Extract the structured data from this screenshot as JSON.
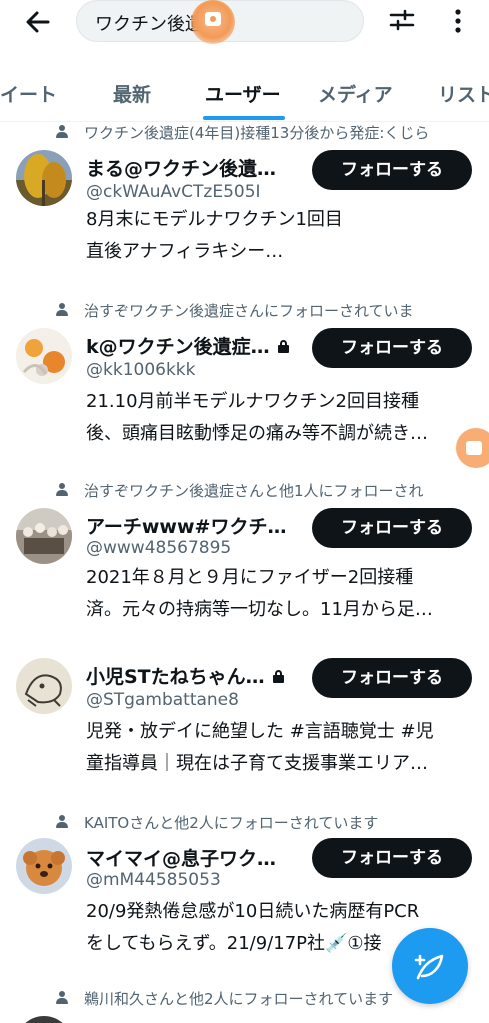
{
  "search": {
    "query": "ワクチン後遺症"
  },
  "tabs": [
    {
      "label": "イート",
      "active": false
    },
    {
      "label": "最新",
      "active": false
    },
    {
      "label": "ユーザー",
      "active": true
    },
    {
      "label": "メディア",
      "active": false
    },
    {
      "label": "リスト",
      "active": false
    }
  ],
  "users": [
    {
      "context": "ワクチン後遺症(4年目)接種13分後から発症:くじら",
      "name": "まる@ワクチン後遺…",
      "handle": "@ckWAuAvCTzE505I",
      "bio": [
        "8月末にモデルナワクチン1回目",
        "直後アナフィラキシー…"
      ],
      "follow_label": "フォローする",
      "locked": false
    },
    {
      "context": "治すぞワクチン後遺症さんにフォローされていま",
      "name": "k@ワクチン後遺症…",
      "handle": "@kk1006kkk",
      "bio": [
        "21.10月前半モデルナワクチン2回目接種",
        "後、頭痛目眩動悸足の痛み等不調が続き…"
      ],
      "follow_label": "フォローする",
      "locked": true
    },
    {
      "context": "治すぞワクチン後遺症さんと他1人にフォローされ",
      "name": "アーチwww#ワクチ…",
      "handle": "@www48567895",
      "bio": [
        "2021年８月と９月にファイザー2回接種",
        "済。元々の持病等一切なし。11月から足…"
      ],
      "follow_label": "フォローする",
      "locked": false
    },
    {
      "context": "",
      "name": "小児STたねちゃん…",
      "handle": "@STgambattane8",
      "bio": [
        "児発・放デイに絶望した #言語聴覚士 #児",
        "童指導員｜現在は子育て支援事業エリア…"
      ],
      "follow_label": "フォローする",
      "locked": true
    },
    {
      "context": "KAITOさんと他2人にフォローされています",
      "name": "マイマイ@息子ワク…",
      "handle": "@mM44585053",
      "bio": [
        "20/9発熱倦怠感が10日続いた病歴有PCR",
        "をしてもらえず。21/9/17P社💉①接"
      ],
      "follow_label": "フォローする",
      "locked": false
    },
    {
      "context": "鵜川和久さんと他2人にフォローされています",
      "name": "",
      "handle": "",
      "bio": [],
      "follow_label": "",
      "locked": false
    }
  ],
  "colors": {
    "accent": "#1d9bf0",
    "text": "#0f1419",
    "secondary": "#536471",
    "button": "#0f1419"
  }
}
